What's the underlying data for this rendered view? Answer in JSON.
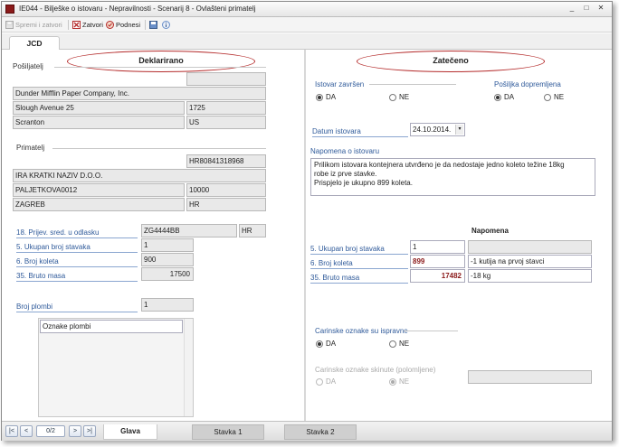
{
  "window": {
    "title": "IE044 - Bilješke o istovaru - Nepravilnosti - Scenarij 8 - Ovlašteni primatelj",
    "controls": [
      "_",
      "□",
      "✕"
    ]
  },
  "toolbar": {
    "save_close": "Spremi i zatvori",
    "close": "Zatvori",
    "submit": "Podnesi"
  },
  "tabs": {
    "jcd": "JCD"
  },
  "declared": {
    "heading": "Deklarirano",
    "sender": {
      "label": "Pošiljatelj",
      "name": "Dunder Mifflin Paper Company, Inc.",
      "street": "Slough Avenue 25",
      "postcode": "1725",
      "city": "Scranton",
      "country": "US"
    },
    "recipient": {
      "label": "Primatelj",
      "id": "HR80841318968",
      "short_name": "IRA KRATKI NAZIV D.O.O.",
      "street": "PALJETKOVA0012",
      "postcode": "10000",
      "city": "ZAGREB",
      "country": "HR"
    },
    "transport": {
      "label": "18. Prijev. sred. u odlasku",
      "value": "ZG4444BB",
      "country": "HR"
    },
    "items_count": {
      "label": "5. Ukupan broj stavaka",
      "value": "1"
    },
    "packages": {
      "label": "6. Broj koleta",
      "value": "900"
    },
    "gross_mass": {
      "label": "35. Bruto masa",
      "value": "17500"
    },
    "seals": {
      "label": "Broj plombi",
      "value": "1",
      "marks_label": "Oznake plombi"
    }
  },
  "found": {
    "heading": "Zatečeno",
    "unloading_done": {
      "label": "Istovar završen",
      "yes": "DA",
      "no": "NE"
    },
    "shipment_complete": {
      "label": "Pošiljka dopremljena",
      "yes": "DA",
      "no": "NE"
    },
    "unloading_date": {
      "label": "Datum istovara",
      "value": "24.10.2014."
    },
    "unloading_note": {
      "label": "Napomena o istovaru",
      "line1": "Prilikom istovara kontejnera utvrđeno je da nedostaje jedno koleto težine 18kg",
      "line2": "robe iz prve stavke.",
      "line3": "Prispjelo je ukupno 899  koleta."
    },
    "note_column": "Napomena",
    "items_count": {
      "label": "5. Ukupan broj stavaka",
      "value": "1",
      "note": ""
    },
    "packages": {
      "label": "6. Broj koleta",
      "value": "899",
      "note": "-1 kutija na prvoj stavci"
    },
    "gross_mass": {
      "label": "35. Bruto masa",
      "value": "17482",
      "note": "-18 kg"
    },
    "seals_ok": {
      "label": "Carinske oznake su ispravne",
      "yes": "DA",
      "no": "NE"
    },
    "seals_removed": {
      "label": "Carinske oznake skinute (polomljene)",
      "yes": "DA",
      "no": "NE"
    }
  },
  "bottom": {
    "pager": "0/2",
    "tabs": [
      "Glava",
      "Stavka 1",
      "Stavka 2"
    ]
  },
  "colors": {
    "accent_red": "#b42a2a",
    "label_blue": "#2f5a9a",
    "changed_value": "#8b1a1a"
  },
  "icons": [
    "app-icon",
    "save-close-icon",
    "close-icon",
    "submit-icon",
    "disk-icon",
    "info-icon",
    "first-icon",
    "prev-icon",
    "next-icon",
    "last-icon"
  ]
}
